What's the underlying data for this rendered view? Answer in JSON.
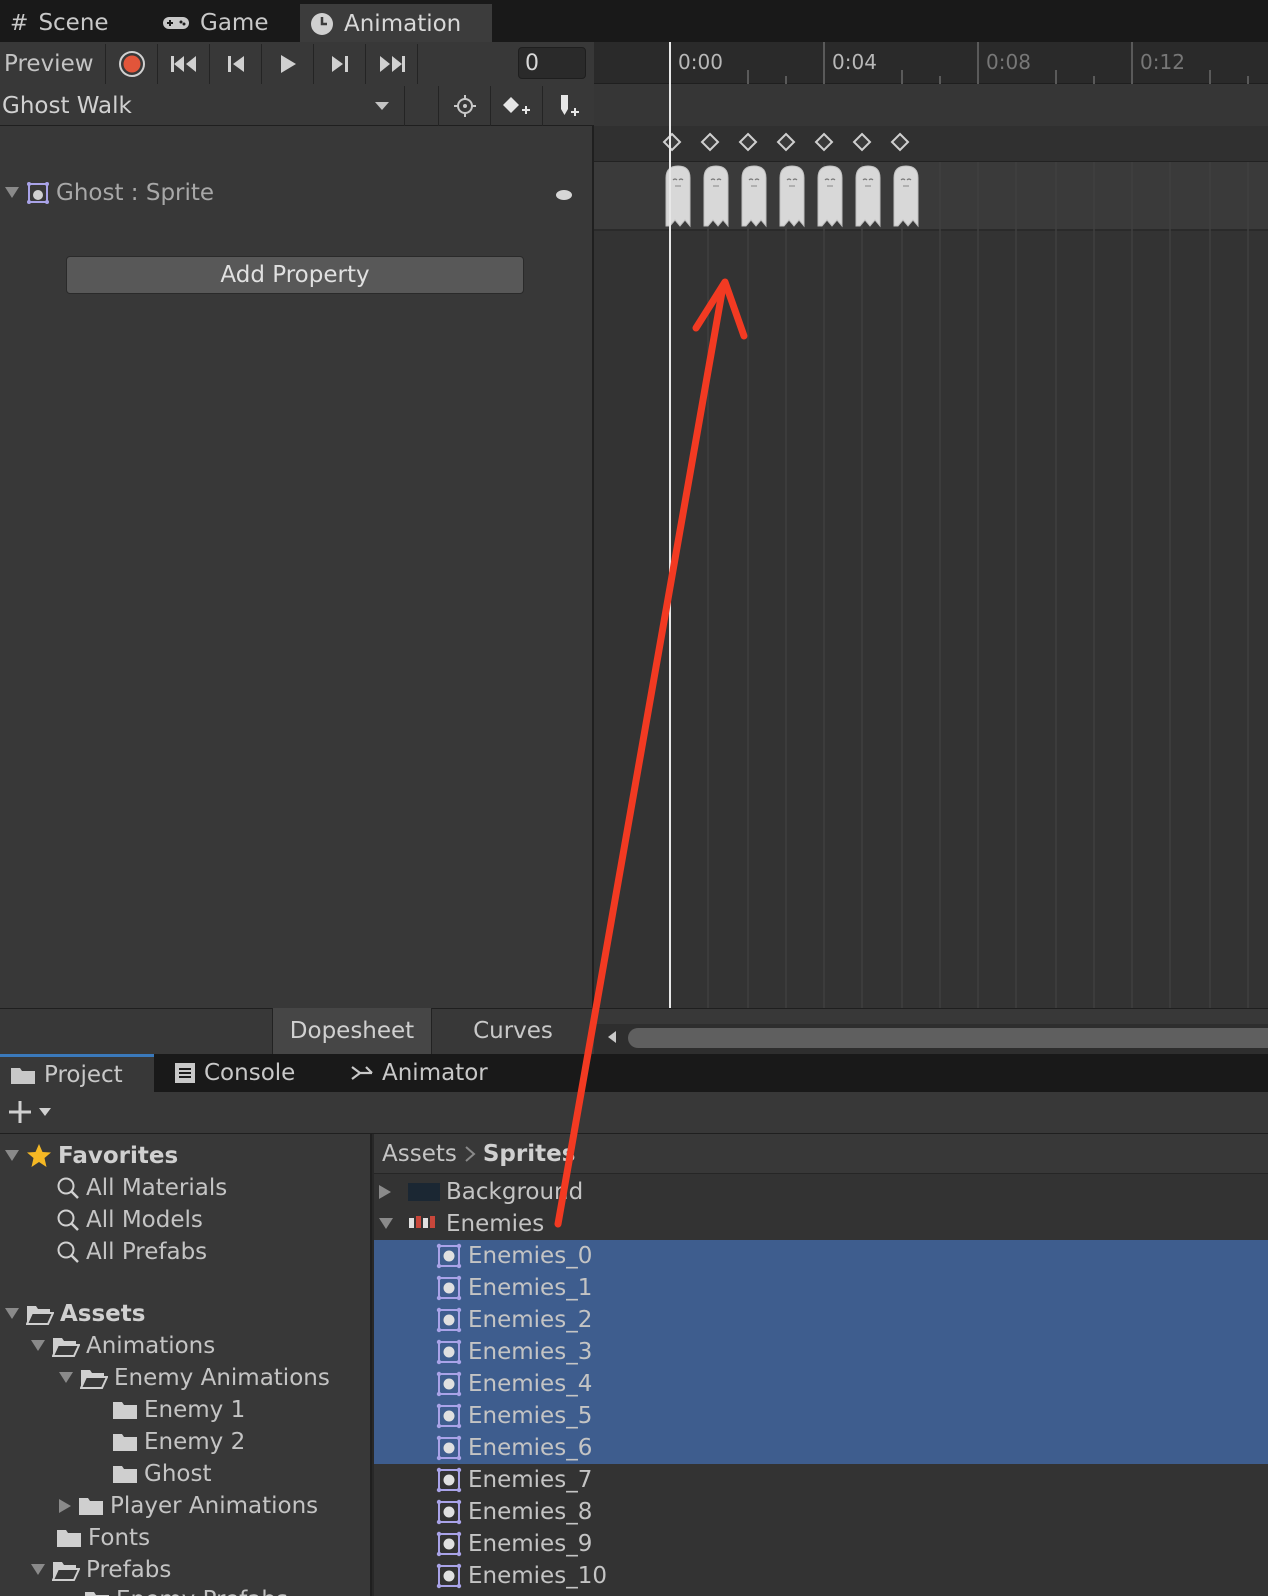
{
  "tabs": [
    {
      "label": "Scene",
      "icon": "grid-icon"
    },
    {
      "label": "Game",
      "icon": "gamepad-icon"
    },
    {
      "label": "Animation",
      "icon": "clock-icon",
      "active": true
    }
  ],
  "toolbar": {
    "preview_label": "Preview",
    "frame_value": "0"
  },
  "clip": {
    "name": "Ghost Walk"
  },
  "property": {
    "label": "Ghost : Sprite",
    "add_property_label": "Add Property"
  },
  "timeline": {
    "ruler_labels": [
      "0:00",
      "0:04",
      "0:08",
      "0:12"
    ],
    "keyframe_count": 7
  },
  "view_tabs": {
    "dopesheet": "Dopesheet",
    "curves": "Curves"
  },
  "project_tabs": [
    {
      "label": "Project",
      "icon": "folder-icon",
      "active": true
    },
    {
      "label": "Console",
      "icon": "console-icon"
    },
    {
      "label": "Animator",
      "icon": "animator-icon"
    }
  ],
  "favorites": {
    "title": "Favorites",
    "items": [
      "All Materials",
      "All Models",
      "All Prefabs"
    ]
  },
  "assets_tree": {
    "title": "Assets",
    "items": [
      {
        "label": "Animations"
      },
      {
        "label": "Enemy Animations"
      },
      {
        "label": "Enemy 1"
      },
      {
        "label": "Enemy 2"
      },
      {
        "label": "Ghost"
      },
      {
        "label": "Player Animations"
      },
      {
        "label": "Fonts"
      },
      {
        "label": "Prefabs"
      },
      {
        "label": "Enemy Prefabs"
      }
    ]
  },
  "breadcrumb": {
    "root": "Assets",
    "current": "Sprites"
  },
  "files": {
    "background": "Background",
    "enemies": "Enemies",
    "sprites": [
      "Enemies_0",
      "Enemies_1",
      "Enemies_2",
      "Enemies_3",
      "Enemies_4",
      "Enemies_5",
      "Enemies_6",
      "Enemies_7",
      "Enemies_8",
      "Enemies_9",
      "Enemies_10"
    ],
    "selected_count": 7
  },
  "colors": {
    "selection": "#3e5d8e",
    "record": "#e2553a",
    "annotation_arrow": "#f23a22",
    "favorite_star": "#f5b824"
  }
}
